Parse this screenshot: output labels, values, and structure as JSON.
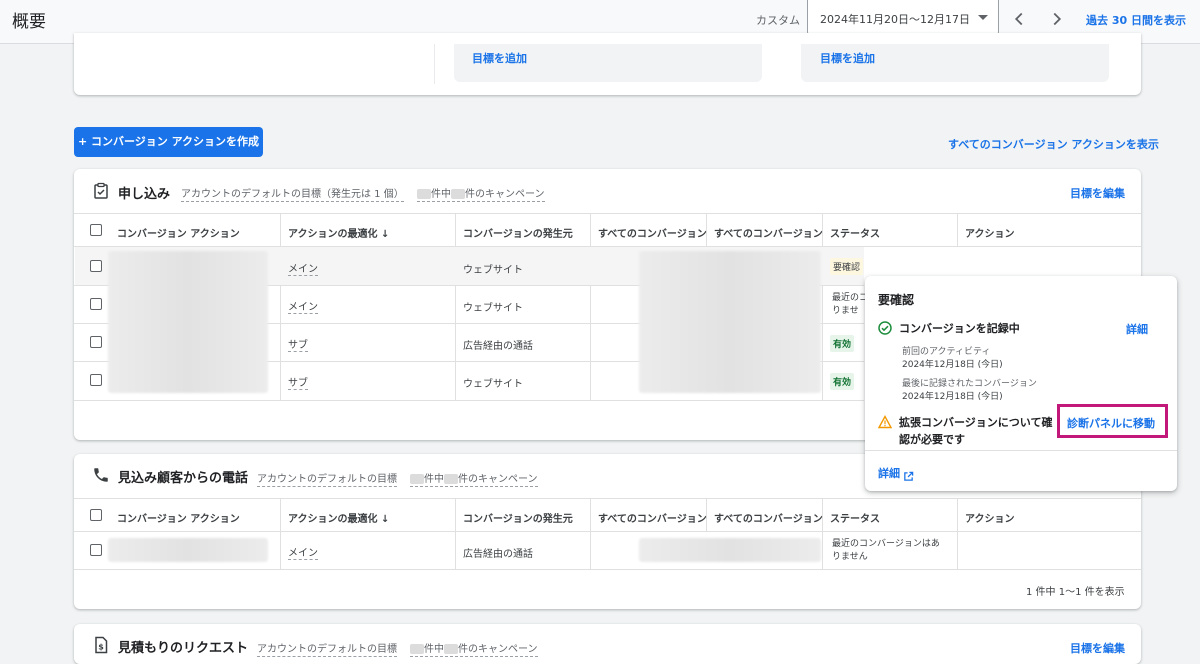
{
  "header": {
    "title": "概要",
    "range_label": "カスタム",
    "date_range": "2024年11月20日～12月17日",
    "past_link": "過去 30 日間を表示"
  },
  "top_card": {
    "add_goal_1": "目標を追加",
    "add_goal_2": "目標を追加"
  },
  "toolbar": {
    "create_button": "+ コンバージョン アクションを作成",
    "all_link": "すべてのコンバージョン アクションを表示"
  },
  "sections": [
    {
      "title": "申し込み",
      "default_goal": "アカウントのデフォルトの目標（発生元は 1 個）",
      "campaigns_mid": "件中",
      "campaigns_end": "件のキャンペーン",
      "edit": "目標を編集",
      "columns": [
        "コンバージョン アクション",
        "アクションの最適化 ↓",
        "コンバージョンの発生元",
        "すべてのコンバージョン",
        "すべてのコンバージョン",
        "ステータス",
        "アクション"
      ],
      "rows": [
        {
          "optimization": "メイン",
          "source": "ウェブサイト",
          "status": "要確認"
        },
        {
          "optimization": "メイン",
          "source": "ウェブサイト",
          "status": "最近のコ\nりませ"
        },
        {
          "optimization": "サブ",
          "source": "広告経由の通話",
          "status": "有効"
        },
        {
          "optimization": "サブ",
          "source": "ウェブサイト",
          "status": "有効"
        }
      ]
    },
    {
      "title": "見込み顧客からの電話",
      "default_goal": "アカウントのデフォルトの目標",
      "campaigns_mid": "件中",
      "campaigns_end": "件のキャンペーン",
      "columns": [
        "コンバージョン アクション",
        "アクションの最適化 ↓",
        "コンバージョンの発生元",
        "すべてのコンバージョン",
        "すべてのコンバージョン",
        "ステータス",
        "アクション"
      ],
      "rows": [
        {
          "optimization": "メイン",
          "source": "広告経由の通話",
          "status_1": "最近のコンバージョンはあ",
          "status_2": "りません"
        }
      ],
      "pagination": "1 件中 1～1 件を表示"
    },
    {
      "title": "見積もりのリクエスト",
      "default_goal": "アカウントのデフォルトの目標",
      "campaigns_mid": "件中",
      "campaigns_end": "件のキャンペーン",
      "edit": "目標を編集"
    }
  ],
  "popover": {
    "title": "要確認",
    "recording": "コンバージョンを記録中",
    "details": "詳細",
    "prev_activity_label": "前回のアクティビティ",
    "prev_activity_date": "2024年12月18日 (今日)",
    "last_conv_label": "最後に記録されたコンバージョン",
    "last_conv_date": "2024年12月18日 (今日)",
    "warning_1": "拡張コンバージョンについて確",
    "warning_2": "認が必要です",
    "diag_link": "診断パネルに移動",
    "more_details": "詳細"
  },
  "colors": {
    "accent": "#1a73e8",
    "highlight": "#c2187a",
    "success": "#1e8e3e",
    "warning": "#f29900"
  }
}
